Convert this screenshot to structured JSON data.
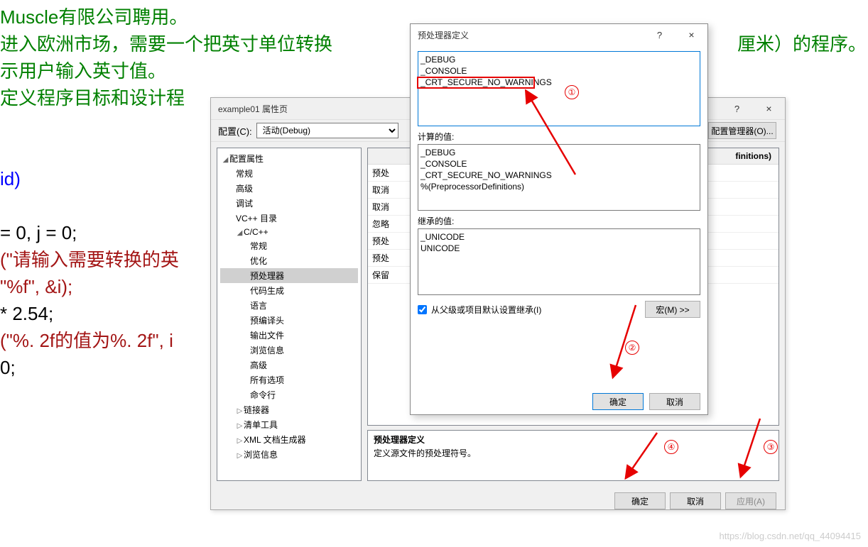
{
  "code": {
    "l1": "Muscle有限公司聘用。",
    "l2": "进入欧洲市场，需要一个把英寸单位转换",
    "l2b": "厘米）的程序。",
    "l3": "示用户输入英寸值。",
    "l4": "定义程序目标和设计程",
    "void": "id)",
    "c1": " = 0, j = 0;",
    "c2a": "(\"请输入需要转换的英",
    "c3a": "\"%f\", &i);",
    "c4": "* 2.54;",
    "c5a": "(\"%. 2f的值为%. 2f\", i",
    "c6": " 0;"
  },
  "propDialog": {
    "title": "example01 属性页",
    "help": "?",
    "close": "×",
    "configLabel": "配置(C):",
    "configValue": "活动(Debug)",
    "cfgMgr": "配置管理器(O)...",
    "tree": {
      "root": "配置属性",
      "items": [
        "常规",
        "高级",
        "调试",
        "VC++ 目录"
      ],
      "ccpp": "C/C++",
      "ccppItems": [
        "常规",
        "优化",
        "预处理器",
        "代码生成",
        "语言",
        "预编译头",
        "输出文件",
        "浏览信息",
        "高级",
        "所有选项",
        "命令行"
      ],
      "tail": [
        "链接器",
        "清单工具",
        "XML 文档生成器",
        "浏览信息"
      ]
    },
    "hdr": "finitions)",
    "labels": [
      "预处",
      "取消",
      "取消",
      "忽略",
      "预处",
      "预处",
      "保留"
    ],
    "desc": {
      "t": "预处理器定义",
      "s": "定义源文件的预处理符号。"
    },
    "ok": "确定",
    "cancel": "取消",
    "apply": "应用(A)"
  },
  "preDialog": {
    "title": "预处理器定义",
    "help": "?",
    "close": "×",
    "mainValue": "_DEBUG\n_CONSOLE\n_CRT_SECURE_NO_WARNINGS",
    "calcLabel": "计算的值:",
    "calcValue": "_DEBUG\n_CONSOLE\n_CRT_SECURE_NO_WARNINGS\n%(PreprocessorDefinitions)",
    "inheritLabel": "继承的值:",
    "inheritValue": "_UNICODE\nUNICODE",
    "chk": "从父级或项目默认设置继承(I)",
    "macro": "宏(M) >>",
    "ok": "确定",
    "cancel": "取消"
  },
  "annot": {
    "n1": "①",
    "n2": "②",
    "n3": "③",
    "n4": "④"
  },
  "watermark": "https://blog.csdn.net/qq_44094415"
}
